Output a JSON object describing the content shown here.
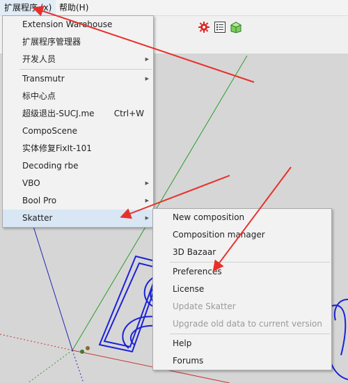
{
  "menubar": {
    "items": [
      {
        "label": "扩展程序 (x)"
      },
      {
        "label": "帮助(H)"
      }
    ]
  },
  "toolbar": {
    "icons": [
      "gear-icon",
      "list-icon",
      "box-icon"
    ]
  },
  "extensions_menu": {
    "items": [
      {
        "label": "Extension Warehouse"
      },
      {
        "label": "扩展程序管理器"
      },
      {
        "label": "开发人员"
      },
      {
        "label": "Transmutr"
      },
      {
        "label": "标中心点"
      },
      {
        "label": "超级退出-SUCJ.me",
        "shortcut": "Ctrl+W"
      },
      {
        "label": "CompoScene"
      },
      {
        "label": "实体修复FixIt-101"
      },
      {
        "label": "Decoding rbe"
      },
      {
        "label": "VBO"
      },
      {
        "label": "Bool Pro"
      },
      {
        "label": "Skatter"
      }
    ]
  },
  "skatter_menu": {
    "items": [
      {
        "label": "New composition"
      },
      {
        "label": "Composition manager"
      },
      {
        "label": "3D Bazaar"
      },
      {
        "label": "Preferences"
      },
      {
        "label": "License"
      },
      {
        "label": "Update Skatter"
      },
      {
        "label": "Upgrade old data to current version"
      },
      {
        "label": "Help"
      },
      {
        "label": "Forums"
      }
    ]
  },
  "colors": {
    "arrow": "#e8302a",
    "axis_green": "#2a9d2a",
    "axis_red": "#c83232",
    "axis_blue": "#2323b4",
    "shape": "#1a22d8"
  }
}
